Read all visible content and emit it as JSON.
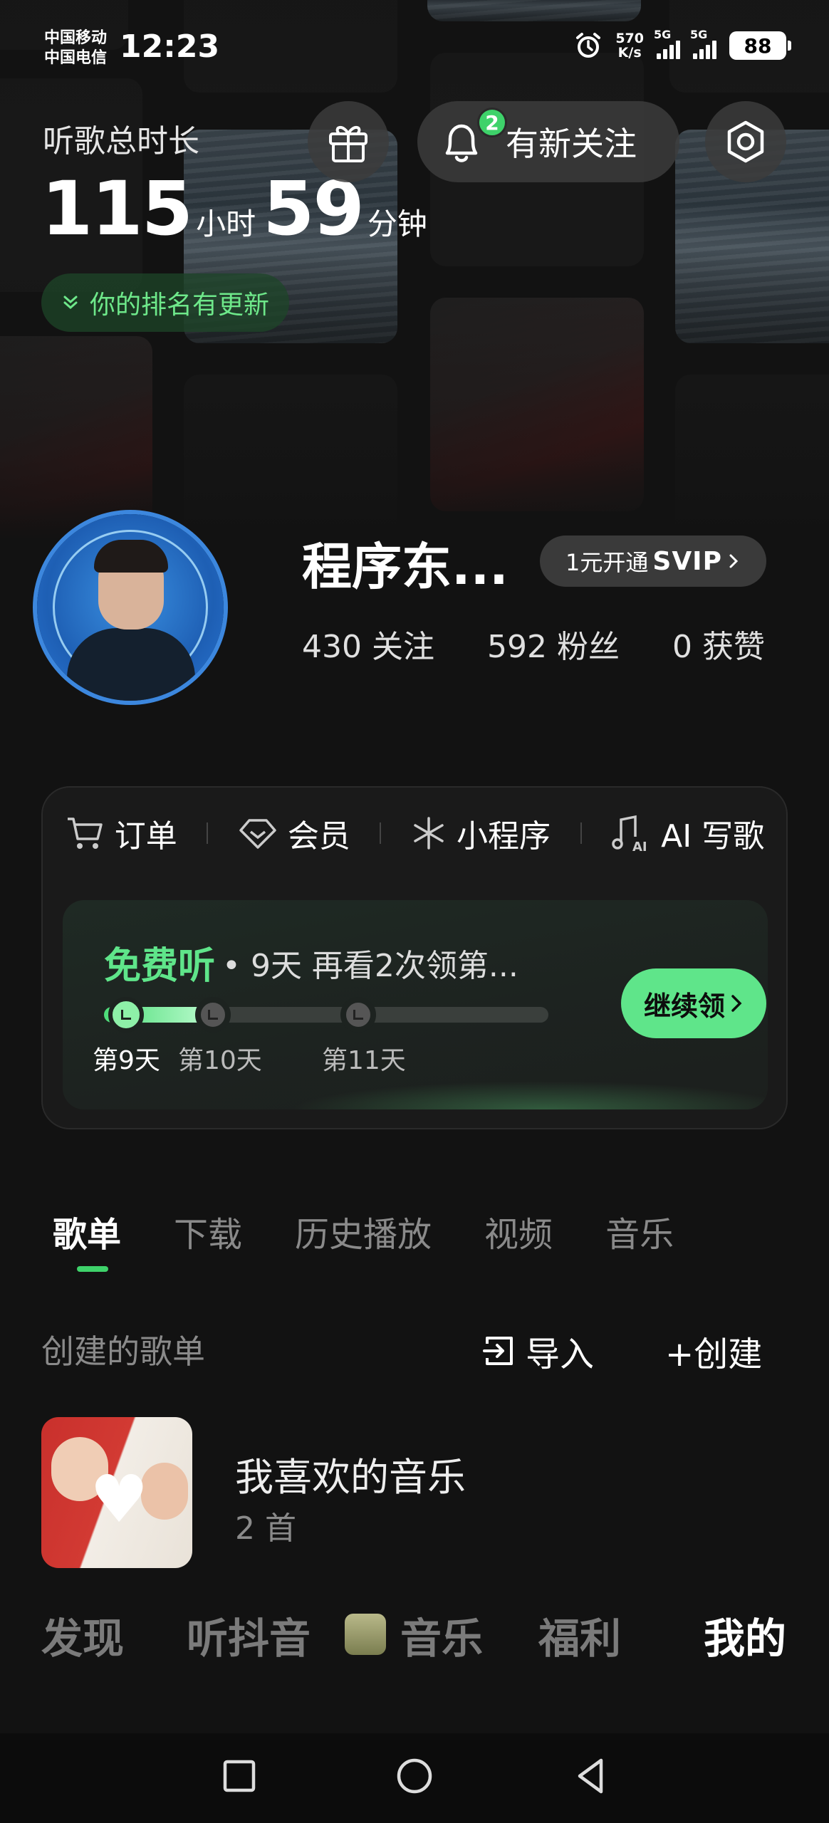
{
  "status_bar": {
    "carrier_1": "中国移动",
    "carrier_2": "中国电信",
    "time": "12:23",
    "net_speed_value": "570",
    "net_speed_unit": "K/s",
    "signal_1": "5G",
    "signal_2": "5G",
    "battery": "88"
  },
  "header": {
    "listen_label": "听歌总时长",
    "hours": "115",
    "hours_unit": "小时",
    "minutes": "59",
    "minutes_unit": "分钟",
    "rank_update": "你的排名有更新",
    "follow_badge": "2",
    "follow_label": "有新关注"
  },
  "profile": {
    "name": "程序东...",
    "svip_prefix": "1元开通",
    "svip_label": "SVIP",
    "following_count": "430",
    "following_label": "关注",
    "fans_count": "592",
    "fans_label": "粉丝",
    "likes_count": "0",
    "likes_label": "获赞"
  },
  "services": {
    "items": [
      {
        "label": "订单",
        "icon": "cart-icon"
      },
      {
        "label": "会员",
        "icon": "diamond-icon"
      },
      {
        "label": "小程序",
        "icon": "asterisk-icon"
      },
      {
        "label": "AI 写歌",
        "icon": "ai-music-icon"
      }
    ]
  },
  "promo": {
    "free_label": "免费听",
    "detail": "• 9天 再看2次领第...",
    "progress": 0.27,
    "days": [
      "第9天",
      "第10天",
      "第11天"
    ],
    "claim_label": "继续领"
  },
  "tabs": [
    "歌单",
    "下载",
    "历史播放",
    "视频",
    "音乐"
  ],
  "playlists_section": {
    "title": "创建的歌单",
    "import_label": "导入",
    "create_label": "+创建",
    "items": [
      {
        "name": "我喜欢的音乐",
        "count": "2 首"
      }
    ]
  },
  "bottom_nav": {
    "discover": "发现",
    "douyin": "听抖音",
    "music": "音乐",
    "welfare": "福利",
    "mine": "我的"
  },
  "colors": {
    "accent": "#5fe58a",
    "background": "#121212"
  }
}
